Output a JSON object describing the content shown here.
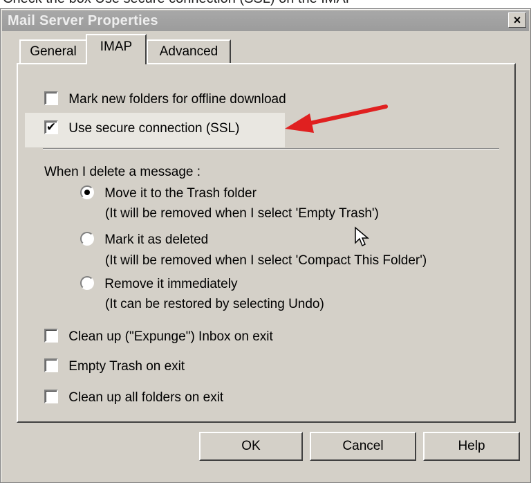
{
  "caption": "Check the box Use secure connection (SSL) on the IMAP",
  "window": {
    "title": "Mail Server Properties",
    "close_glyph": "×"
  },
  "tabs": [
    {
      "label": "General",
      "active": false
    },
    {
      "label": "IMAP",
      "active": true
    },
    {
      "label": "Advanced",
      "active": false
    }
  ],
  "options": {
    "offline_download": {
      "label": "Mark new folders for offline download",
      "checked": false
    },
    "use_ssl": {
      "label": "Use secure connection (SSL)",
      "checked": true
    },
    "delete_heading": "When I delete a message :",
    "move_trash": {
      "label": "Move it to the Trash folder",
      "note": "(It will be removed when I select 'Empty Trash')",
      "selected": true
    },
    "mark_deleted": {
      "label": "Mark it as deleted",
      "note": "(It will be removed when I select 'Compact This Folder')",
      "selected": false
    },
    "remove_now": {
      "label": "Remove it immediately",
      "note": "(It can be restored by selecting Undo)",
      "selected": false
    },
    "expunge": {
      "label": "Clean up (\"Expunge\") Inbox on exit",
      "checked": false
    },
    "empty_trash": {
      "label": "Empty Trash on exit",
      "checked": false
    },
    "cleanup_all": {
      "label": "Clean up all folders on exit",
      "checked": false
    }
  },
  "buttons": {
    "ok": "OK",
    "cancel": "Cancel",
    "help": "Help"
  },
  "check_glyph": "✔",
  "colors": {
    "annotation_arrow": "#e02020",
    "highlight": "#e9e7e1",
    "titlebar": "#a0a0a0"
  },
  "icons": {
    "annotation": "red-arrow-icon",
    "pointer": "mouse-cursor-icon"
  }
}
